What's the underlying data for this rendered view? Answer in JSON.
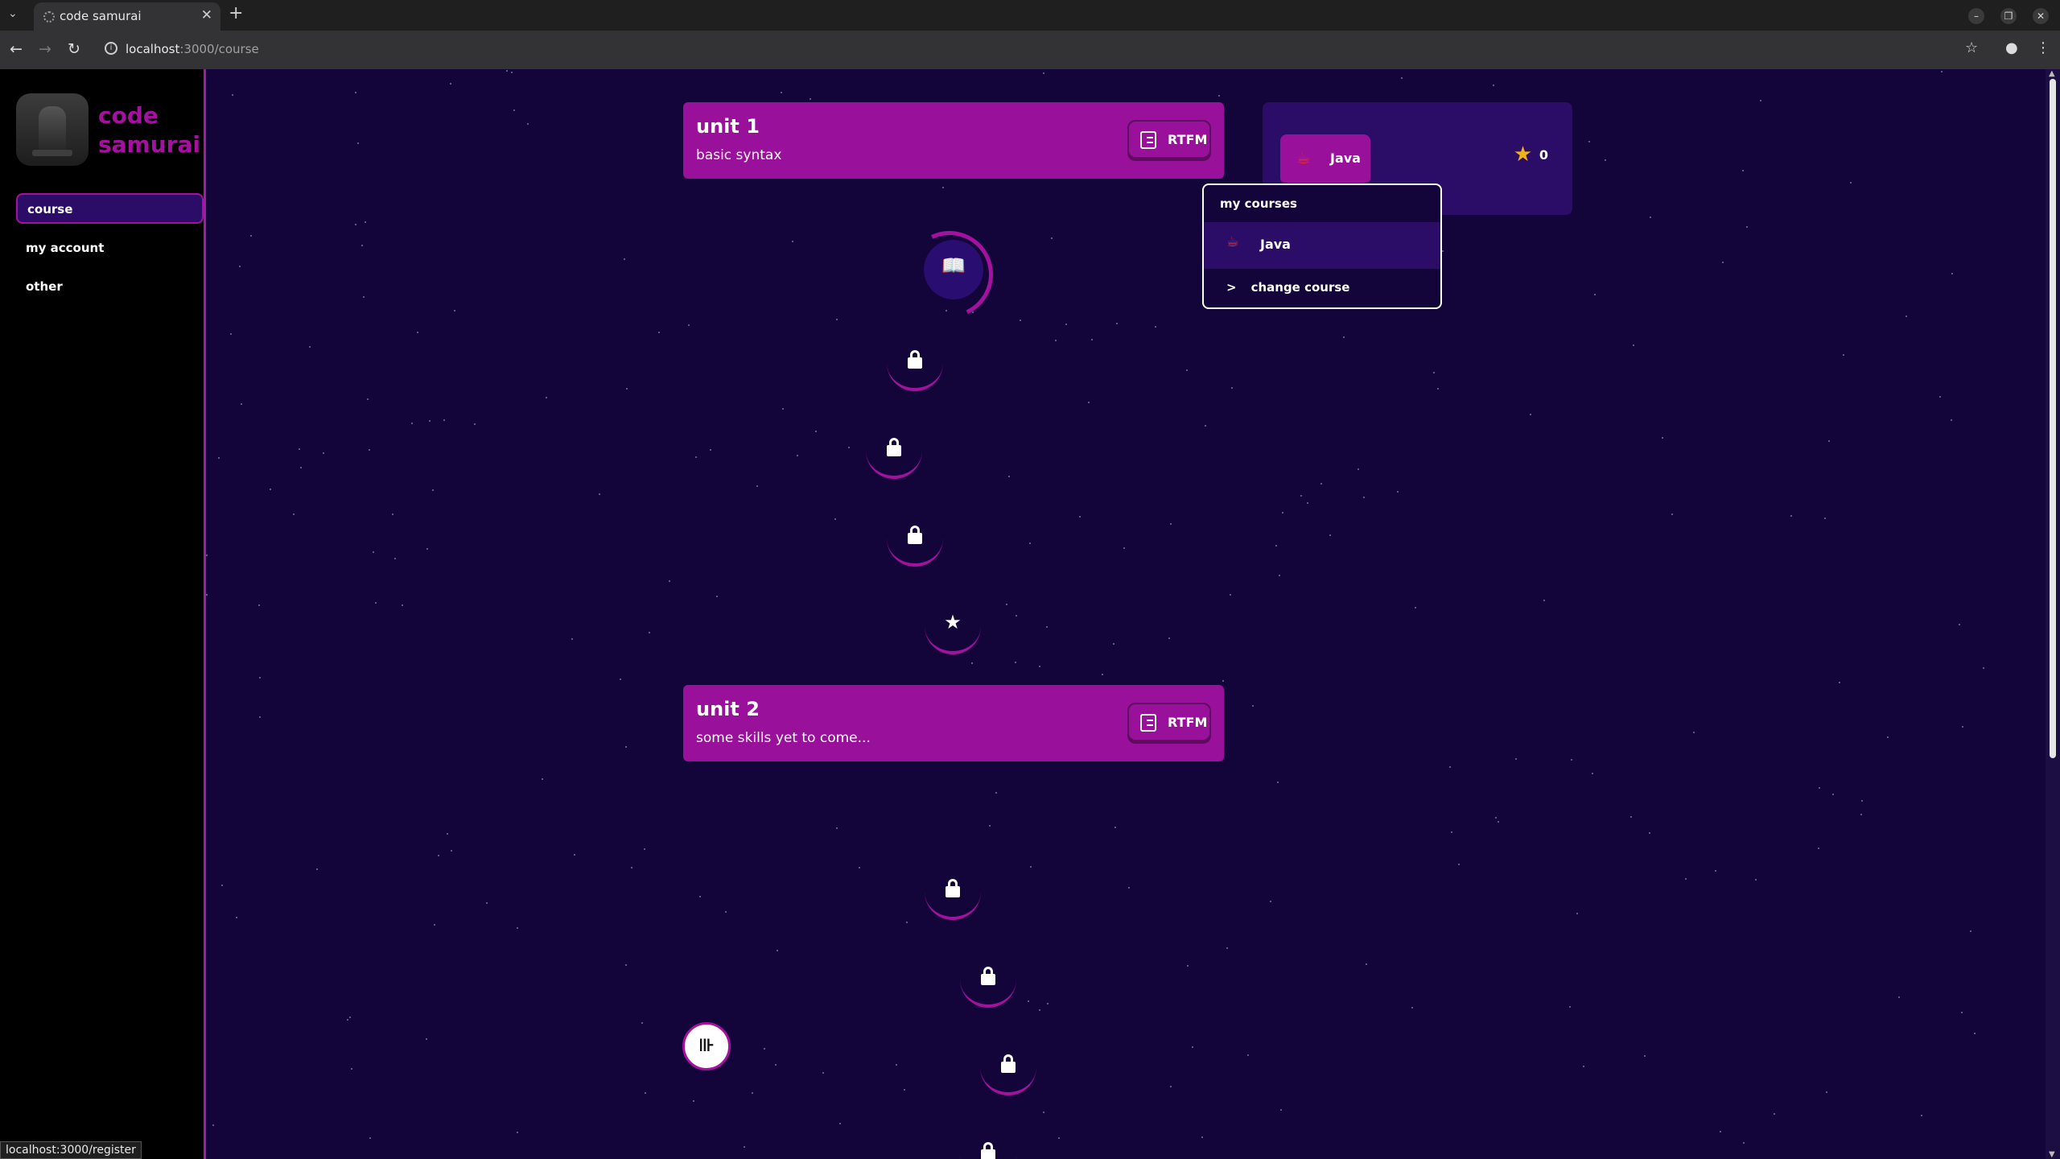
{
  "browser": {
    "tab_title": "code samurai",
    "url_host": "localhost",
    "url_path": ":3000/course",
    "status_url": "localhost:3000/register"
  },
  "sidebar": {
    "brand_line1": "code",
    "brand_line2": "samurai",
    "items": [
      {
        "label": "course",
        "active": true
      },
      {
        "label": "my account",
        "active": false
      },
      {
        "label": "other",
        "active": false
      }
    ]
  },
  "units": [
    {
      "title": "unit 1",
      "subtitle": "basic syntax",
      "button": "RTFM"
    },
    {
      "title": "unit 2",
      "subtitle": "some skills yet to come...",
      "button": "RTFM"
    }
  ],
  "course_panel": {
    "course_name": "Java",
    "xp": "0",
    "accent": "#99109b"
  },
  "dropdown": {
    "header": "my courses",
    "courses": [
      "Java"
    ],
    "change_chevron": ">",
    "change_label": "change course"
  },
  "colors": {
    "background": "#13053a",
    "accent": "#a3119e",
    "panel": "#2b0d68"
  }
}
